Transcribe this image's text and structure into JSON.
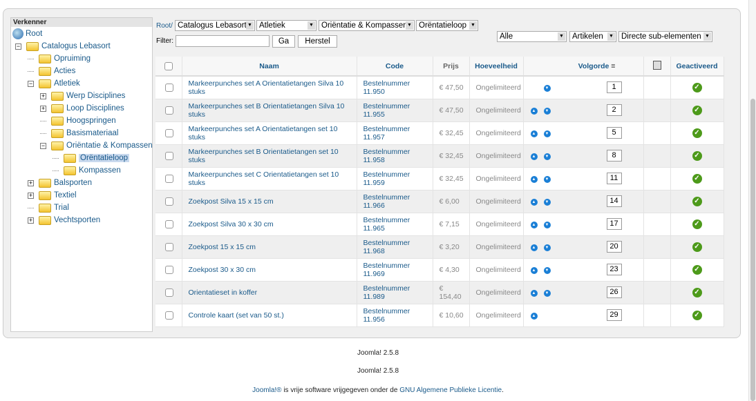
{
  "tree": {
    "header": "Verkenner",
    "root": "Root",
    "nodes": [
      {
        "label": "Catalogus Lebasort",
        "depth": 1,
        "exp": "-"
      },
      {
        "label": "Opruiming",
        "depth": 2,
        "exp": ""
      },
      {
        "label": "Acties",
        "depth": 2,
        "exp": ""
      },
      {
        "label": "Atletiek",
        "depth": 2,
        "exp": "-"
      },
      {
        "label": "Werp Disciplines",
        "depth": 3,
        "exp": "+"
      },
      {
        "label": "Loop Disciplines",
        "depth": 3,
        "exp": "+"
      },
      {
        "label": "Hoogspringen",
        "depth": 3,
        "exp": ""
      },
      {
        "label": "Basismateriaal",
        "depth": 3,
        "exp": ""
      },
      {
        "label": "Oriëntatie & Kompassen",
        "depth": 3,
        "exp": "-"
      },
      {
        "label": "Orëntatieloop",
        "depth": 4,
        "exp": "",
        "selected": true
      },
      {
        "label": "Kompassen",
        "depth": 4,
        "exp": ""
      },
      {
        "label": "Balsporten",
        "depth": 2,
        "exp": "+"
      },
      {
        "label": "Textiel",
        "depth": 2,
        "exp": "+"
      },
      {
        "label": "Trial",
        "depth": 2,
        "exp": ""
      },
      {
        "label": "Vechtsporten",
        "depth": 2,
        "exp": "+"
      }
    ]
  },
  "breadcrumb": {
    "root": "Root/",
    "selects": [
      "Catalogus Lebasort",
      "Atletiek",
      "Oriëntatie & Kompassen",
      "Orëntatieloop"
    ]
  },
  "filter": {
    "label": "Filter:",
    "value": "",
    "go": "Ga",
    "reset": "Herstel"
  },
  "dropdowns": {
    "status": "Alle",
    "type": "Artikelen",
    "scope": "Directe sub-elementen"
  },
  "table": {
    "headers": {
      "name": "Naam",
      "code": "Code",
      "price": "Prijs",
      "qty": "Hoeveelheid",
      "order": "Volgorde",
      "active": "Geactiveerd"
    },
    "rows": [
      {
        "name": "Markeerpunches set A Orientatietangen Silva 10 stuks",
        "code": "Bestelnummer 11.950",
        "price": "€ 47,50",
        "qty": "Ongelimiteerd",
        "order": "1",
        "up": false,
        "down": true
      },
      {
        "name": "Markeerpunches set B Orientatietangen Silva 10 stuks",
        "code": "Bestelnummer 11.955",
        "price": "€ 47,50",
        "qty": "Ongelimiteerd",
        "order": "2",
        "up": true,
        "down": true
      },
      {
        "name": "Markeerpunches set A Orientatietangen set 10 stuks",
        "code": "Bestelnummer 11.957",
        "price": "€ 32,45",
        "qty": "Ongelimiteerd",
        "order": "5",
        "up": true,
        "down": true
      },
      {
        "name": "Markeerpunches set B Orientatietangen set 10 stuks",
        "code": "Bestelnummer 11.958",
        "price": "€ 32,45",
        "qty": "Ongelimiteerd",
        "order": "8",
        "up": true,
        "down": true
      },
      {
        "name": "Markeerpunches set C Orientatietangen set 10 stuks",
        "code": "Bestelnummer 11.959",
        "price": "€ 32,45",
        "qty": "Ongelimiteerd",
        "order": "11",
        "up": true,
        "down": true
      },
      {
        "name": "Zoekpost Silva 15 x 15 cm",
        "code": "Bestelnummer 11.966",
        "price": "€ 6,00",
        "qty": "Ongelimiteerd",
        "order": "14",
        "up": true,
        "down": true
      },
      {
        "name": "Zoekpost Silva 30 x 30 cm",
        "code": "Bestelnummer 11.965",
        "price": "€ 7,15",
        "qty": "Ongelimiteerd",
        "order": "17",
        "up": true,
        "down": true
      },
      {
        "name": "Zoekpost 15 x 15 cm",
        "code": "Bestelnummer 11.968",
        "price": "€ 3,20",
        "qty": "Ongelimiteerd",
        "order": "20",
        "up": true,
        "down": true
      },
      {
        "name": "Zoekpost 30 x 30 cm",
        "code": "Bestelnummer 11.969",
        "price": "€ 4,30",
        "qty": "Ongelimiteerd",
        "order": "23",
        "up": true,
        "down": true
      },
      {
        "name": "Orientatieset in koffer",
        "code": "Bestelnummer 11.989",
        "price": "€ 154,40",
        "qty": "Ongelimiteerd",
        "order": "26",
        "up": true,
        "down": true
      },
      {
        "name": "Controle kaart (set van 50 st.)",
        "code": "Bestelnummer 11.956",
        "price": "€ 10,60",
        "qty": "Ongelimiteerd",
        "order": "29",
        "up": true,
        "down": false
      }
    ]
  },
  "footer": {
    "version1": "Joomla! 2.5.8",
    "version2": "Joomla! 2.5.8",
    "joomla_link": "Joomla!®",
    "text": " is vrije software vrijgegeven onder de ",
    "license_link": "GNU Algemene Publieke Licentie",
    "end": "."
  }
}
